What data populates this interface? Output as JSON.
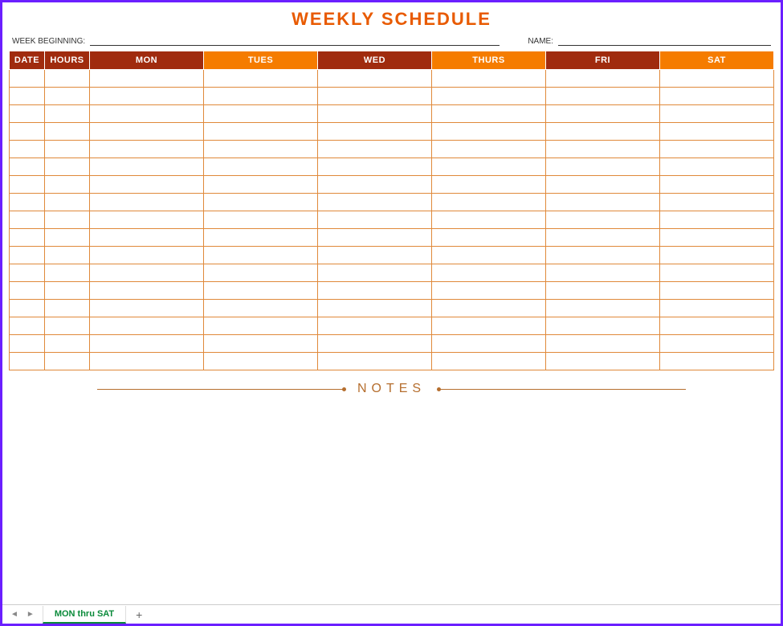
{
  "title": "WEEKLY SCHEDULE",
  "meta": {
    "week_beginning_label": "WEEK BEGINNING:",
    "week_beginning_value": "",
    "name_label": "NAME:",
    "name_value": ""
  },
  "columns": {
    "date": "DATE",
    "hours": "HOURS",
    "days": [
      "MON",
      "TUES",
      "WED",
      "THURS",
      "FRI",
      "SAT"
    ]
  },
  "row_count": 17,
  "notes_label": "NOTES",
  "tabs": {
    "active": "MON thru SAT",
    "add": "+"
  },
  "nav": {
    "prev": "◄",
    "next": "►"
  }
}
